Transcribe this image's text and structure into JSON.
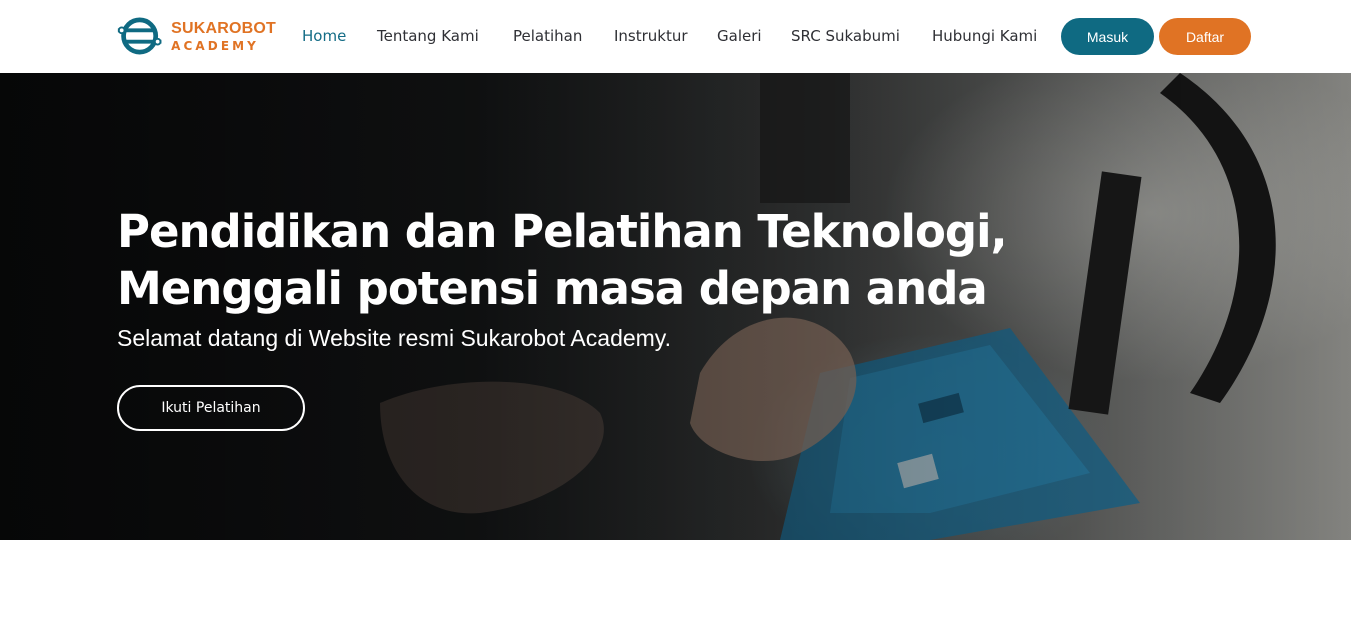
{
  "brand": {
    "name_top": "SUKAROBOT",
    "name_bottom": "ACADEMY",
    "primary_color": "#0f6a82",
    "accent_color": "#e07324"
  },
  "nav": {
    "items": [
      {
        "label": "Home",
        "active": true
      },
      {
        "label": "Tentang Kami"
      },
      {
        "label": "Pelatihan"
      },
      {
        "label": "Instruktur"
      },
      {
        "label": "Galeri"
      },
      {
        "label": "SRC Sukabumi"
      },
      {
        "label": "Hubungi Kami"
      }
    ],
    "login_label": "Masuk",
    "register_label": "Daftar"
  },
  "hero": {
    "title_line1": "Pendidikan dan Pelatihan Teknologi,",
    "title_line2": "Menggali potensi masa depan anda",
    "subtitle": "Selamat datang di Website resmi Sukarobot Academy.",
    "cta_label": "Ikuti Pelatihan"
  }
}
